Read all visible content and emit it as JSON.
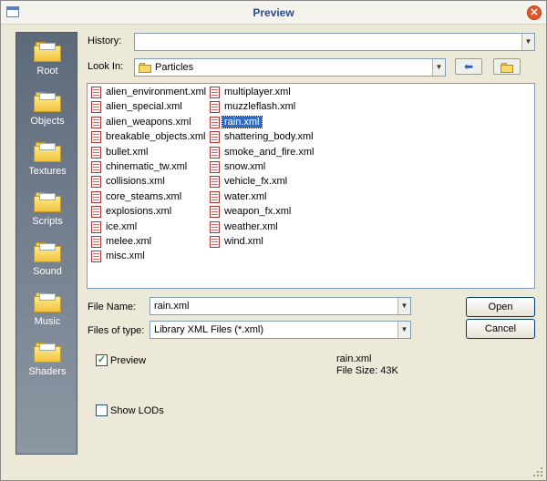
{
  "window": {
    "title": "Preview"
  },
  "sidebar": {
    "items": [
      {
        "label": "Root"
      },
      {
        "label": "Objects"
      },
      {
        "label": "Textures"
      },
      {
        "label": "Scripts"
      },
      {
        "label": "Sound"
      },
      {
        "label": "Music"
      },
      {
        "label": "Shaders"
      }
    ]
  },
  "history": {
    "label": "History:",
    "value": ""
  },
  "look_in": {
    "label": "Look In:",
    "value": "Particles"
  },
  "files": [
    "alien_environment.xml",
    "alien_special.xml",
    "alien_weapons.xml",
    "breakable_objects.xml",
    "bullet.xml",
    "chinematic_tw.xml",
    "collisions.xml",
    "core_steams.xml",
    "explosions.xml",
    "ice.xml",
    "melee.xml",
    "misc.xml",
    "multiplayer.xml",
    "muzzleflash.xml",
    "rain.xml",
    "shattering_body.xml",
    "smoke_and_fire.xml",
    "snow.xml",
    "vehicle_fx.xml",
    "water.xml",
    "weapon_fx.xml",
    "weather.xml",
    "wind.xml"
  ],
  "selected_file": "rain.xml",
  "file_name": {
    "label": "File Name:",
    "value": "rain.xml"
  },
  "file_type": {
    "label": "Files of type:",
    "value": "Library XML Files (*.xml)"
  },
  "buttons": {
    "open": "Open",
    "cancel": "Cancel"
  },
  "preview": {
    "label": "Preview",
    "checked": true
  },
  "info": {
    "name": "rain.xml",
    "size": "File Size: 43K"
  },
  "show_lods": {
    "label": "Show LODs",
    "checked": false
  }
}
